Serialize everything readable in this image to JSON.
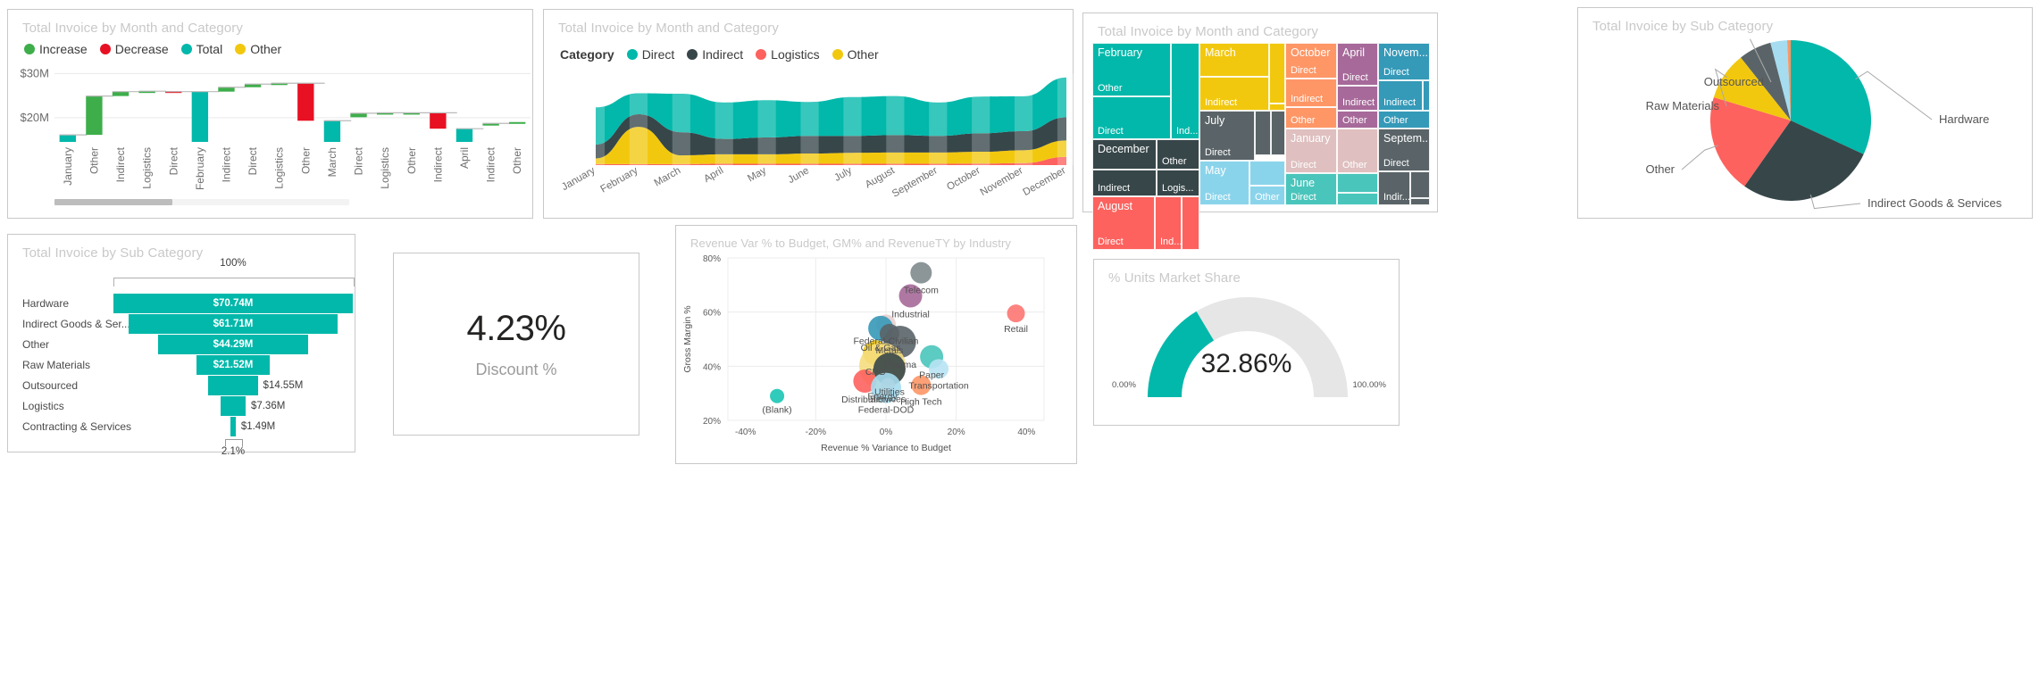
{
  "cards": {
    "waterfall": {
      "title": "Total Invoice by Month and Category"
    },
    "area": {
      "title": "Total Invoice by Month and Category"
    },
    "treemap": {
      "title": "Total Invoice by Month and Category"
    },
    "pie": {
      "title": "Total Invoice by Sub Category"
    },
    "funnel": {
      "title": "Total Invoice by Sub Category"
    },
    "kpi": {
      "value": "4.23%",
      "label": "Discount %"
    },
    "scatter": {
      "title": "Revenue Var % to Budget, GM% and RevenueTY by Industry"
    },
    "gauge": {
      "title": "% Units Market Share",
      "value": "32.86%",
      "min": "0.00%",
      "max": "100.00%"
    }
  },
  "colors": {
    "teal": "#01b8aa",
    "dark": "#374649",
    "red": "#fd625e",
    "yellow": "#f2c80f",
    "green": "#3dae4a",
    "pure_red": "#e81123",
    "gray": "#8ad4eb",
    "orange": "#fe9666",
    "purple": "#a66999",
    "blue": "#3599b8",
    "pink": "#dfbfbf",
    "slate": "#4ac5bb",
    "track": "#e6e6e6"
  },
  "chart_data": [
    {
      "type": "bar",
      "name": "waterfall",
      "title": "Total Invoice by Month and Category",
      "legend": [
        {
          "label": "Increase",
          "color": "#3dae4a"
        },
        {
          "label": "Decrease",
          "color": "#e81123"
        },
        {
          "label": "Total",
          "color": "#01b8aa"
        },
        {
          "label": "Other",
          "color": "#f2c80f"
        }
      ],
      "legend_position": "top-left",
      "ylabel": "",
      "xlabel": "",
      "ytick_labels": [
        "$30M",
        "$20M"
      ],
      "ylim": [
        14.5,
        31.5
      ],
      "grid": true,
      "categories": [
        "January",
        "Other",
        "Indirect",
        "Logistics",
        "Direct",
        "February",
        "Indirect",
        "Direct",
        "Logistics",
        "Other",
        "March",
        "Direct",
        "Logistics",
        "Other",
        "Indirect",
        "April",
        "Indirect",
        "Other"
      ],
      "kinds": [
        "total",
        "increase",
        "increase",
        "increase",
        "decrease",
        "total",
        "increase",
        "increase",
        "increase",
        "decrease",
        "total",
        "increase",
        "increase",
        "increase",
        "decrease",
        "total",
        "increase",
        "increase"
      ],
      "base": [
        14.5,
        16.1,
        24.9,
        25.9,
        26.0,
        14.5,
        25.9,
        26.9,
        27.6,
        19.3,
        14.5,
        20.1,
        21.0,
        21.1,
        17.5,
        14.5,
        18.2,
        18.7
      ],
      "top": [
        16.1,
        24.9,
        25.9,
        26.0,
        25.9,
        25.9,
        26.9,
        27.6,
        27.8,
        27.8,
        19.3,
        21.0,
        21.1,
        21.1,
        21.1,
        17.5,
        18.7,
        19.0
      ],
      "scroll_fraction": 0.4
    },
    {
      "type": "area",
      "name": "stacked-area",
      "title": "Total Invoice by Month and Category",
      "legend_title": "Category",
      "legend": [
        {
          "label": "Direct",
          "color": "#01b8aa"
        },
        {
          "label": "Indirect",
          "color": "#374649"
        },
        {
          "label": "Logistics",
          "color": "#fd625e"
        },
        {
          "label": "Other",
          "color": "#f2c80f"
        }
      ],
      "legend_position": "top-left",
      "categories": [
        "January",
        "February",
        "March",
        "April",
        "May",
        "June",
        "July",
        "August",
        "September",
        "October",
        "November",
        "December"
      ],
      "series": [
        {
          "name": "Logistics",
          "color": "#fd625e",
          "values": [
            0.4,
            0.4,
            0.4,
            0.5,
            0.5,
            0.5,
            0.5,
            0.5,
            0.5,
            0.6,
            0.8,
            3.2
          ]
        },
        {
          "name": "Other",
          "color": "#f2c80f",
          "values": [
            2.2,
            14.5,
            3.4,
            3.7,
            3.7,
            4.0,
            4.3,
            4.4,
            4.4,
            4.6,
            5.0,
            6.4
          ]
        },
        {
          "name": "Indirect",
          "color": "#374649",
          "values": [
            5.4,
            4.9,
            9.0,
            6.0,
            6.6,
            6.9,
            6.6,
            6.8,
            6.5,
            7.2,
            7.4,
            9.0
          ]
        },
        {
          "name": "Direct",
          "color": "#01b8aa",
          "values": [
            14.5,
            8.2,
            15.0,
            14.2,
            14.5,
            13.2,
            15.1,
            15.2,
            13.0,
            14.3,
            13.6,
            15.5
          ]
        }
      ],
      "grid": false,
      "xlabel": "",
      "ylabel": ""
    },
    {
      "type": "treemap",
      "name": "treemap",
      "title": "Total Invoice by Month and Category",
      "nodes": [
        {
          "month": "February",
          "color": "#01b8aa",
          "sub": [
            "Other",
            "Direct",
            "Ind..."
          ]
        },
        {
          "month": "December",
          "color": "#374649",
          "sub": [
            "Other",
            "Indirect",
            "Logis..."
          ]
        },
        {
          "month": "August",
          "color": "#fd625e",
          "sub": [
            "Direct",
            "Ind..."
          ]
        },
        {
          "month": "March",
          "color": "#f2c80f",
          "sub": [
            "Indirect"
          ]
        },
        {
          "month": "July",
          "color": "#5a6468",
          "sub": [
            "Direct"
          ]
        },
        {
          "month": "May",
          "color": "#8ad4eb",
          "sub": [
            "Direct",
            "Other"
          ]
        },
        {
          "month": "October",
          "color": "#fe9666",
          "sub": [
            "Direct",
            "Indirect",
            "Other"
          ]
        },
        {
          "month": "January",
          "color": "#dfbfbf",
          "sub": [
            "Direct",
            "Other"
          ]
        },
        {
          "month": "June",
          "color": "#4ac5bb",
          "sub": [
            "Direct"
          ]
        },
        {
          "month": "April",
          "color": "#a66999",
          "sub": [
            "Direct",
            "Indirect",
            "Other"
          ]
        },
        {
          "month": "Novem...",
          "color": "#3599b8",
          "sub": [
            "Direct",
            "Indirect",
            "Other"
          ]
        },
        {
          "month": "Septem...",
          "color": "#5a6468",
          "sub": [
            "Direct",
            "Indir..."
          ]
        }
      ]
    },
    {
      "type": "pie",
      "name": "pie-subcategory",
      "title": "Total Invoice by Sub Category",
      "labels": [
        "Hardware",
        "Indirect Goods & Services",
        "Other",
        "Raw Materials",
        "Outsourced",
        "",
        ""
      ],
      "slices": [
        {
          "label": "Hardware",
          "value": 31.4,
          "color": "#01b8aa"
        },
        {
          "label": "Indirect Goods & Services",
          "value": 27.4,
          "color": "#374649"
        },
        {
          "label": "Other",
          "value": 19.6,
          "color": "#fd625e"
        },
        {
          "label": "Raw Materials",
          "value": 9.5,
          "color": "#f2c80f"
        },
        {
          "label": "Outsourced",
          "value": 6.5,
          "color": "#5a6468"
        },
        {
          "label": "",
          "value": 3.3,
          "color": "#a5dcf0"
        },
        {
          "label": "",
          "value": 0.7,
          "color": "#fe9666"
        }
      ]
    },
    {
      "type": "funnel",
      "name": "funnel-subcategory",
      "title": "Total Invoice by Sub Category",
      "top_label": "100%",
      "bottom_label": "2.1%",
      "categories": [
        "Hardware",
        "Indirect Goods & Ser...",
        "Other",
        "Raw Materials",
        "Outsourced",
        "Logistics",
        "Contracting & Services"
      ],
      "value_labels": [
        "$70.74M",
        "$61.71M",
        "$44.29M",
        "$21.52M",
        "$14.55M",
        "$7.36M",
        "$1.49M"
      ],
      "values": [
        70.74,
        61.71,
        44.29,
        21.52,
        14.55,
        7.36,
        1.49
      ],
      "max": 70.74,
      "color": "#01b8aa"
    },
    {
      "type": "scatter",
      "name": "bubble-industry",
      "title": "Revenue Var % to Budget, GM% and RevenueTY by Industry",
      "xlabel": "Revenue % Variance to Budget",
      "ylabel": "Gross Margin %",
      "xtick_labels": [
        "-40%",
        "-20%",
        "0%",
        "20%",
        "40%"
      ],
      "ytick_labels": [
        "20%",
        "40%",
        "60%",
        "80%"
      ],
      "xlim": [
        -45,
        45
      ],
      "ylim": [
        20,
        80
      ],
      "grid": true,
      "points": [
        {
          "label": "Telecom",
          "x": 10,
          "y": 74.5,
          "r": 12,
          "color": "#808b8e"
        },
        {
          "label": "Industrial",
          "x": 7,
          "y": 66,
          "r": 13,
          "color": "#a66999"
        },
        {
          "label": "Retail",
          "x": 37,
          "y": 59.5,
          "r": 10,
          "color": "#fd7672"
        },
        {
          "label": "Federal-Civilian",
          "x": 0,
          "y": 55.5,
          "r": 11,
          "color": "#e6cfcf"
        },
        {
          "label": "Oil & Gas",
          "x": -1.5,
          "y": 54,
          "r": 14,
          "color": "#3599b8"
        },
        {
          "label": "Metals",
          "x": 1,
          "y": 52,
          "r": 11,
          "color": "#5a6468"
        },
        {
          "label": "Pharma",
          "x": 4,
          "y": 49,
          "r": 18,
          "color": "#5a6468"
        },
        {
          "label": "CPG",
          "x": -3,
          "y": 45,
          "r": 14,
          "color": "#f2c80f"
        },
        {
          "label": "Paper",
          "x": 13,
          "y": 43.5,
          "r": 13,
          "color": "#4ac5bb"
        },
        {
          "label": "Energy",
          "x": -1,
          "y": 40,
          "r": 26,
          "color": "#f5dd7e"
        },
        {
          "label": "Utilities",
          "x": 1,
          "y": 39,
          "r": 18,
          "color": "#374649"
        },
        {
          "label": "Transportation",
          "x": 15,
          "y": 39,
          "r": 11,
          "color": "#b8e3f4"
        },
        {
          "label": "Distribution",
          "x": -6,
          "y": 34.5,
          "r": 13,
          "color": "#fd625e"
        },
        {
          "label": "High Tech",
          "x": 10,
          "y": 33,
          "r": 11,
          "color": "#fe9666"
        },
        {
          "label": "Services",
          "x": 0.5,
          "y": 33,
          "r": 8,
          "color": "#f0a58a"
        },
        {
          "label": "Federal-DOD",
          "x": 0,
          "y": 32,
          "r": 17,
          "color": "#a5dcf0"
        },
        {
          "label": "(Blank)",
          "x": -31,
          "y": 29,
          "r": 8,
          "color": "#1bc5b4"
        }
      ]
    },
    {
      "type": "gauge",
      "name": "gauge-market-share",
      "title": "% Units Market Share",
      "value": 32.86,
      "value_label": "32.86%",
      "min": 0,
      "min_label": "0.00%",
      "max": 100,
      "max_label": "100.00%",
      "fill_color": "#01b8aa",
      "track_color": "#e6e6e6"
    }
  ]
}
